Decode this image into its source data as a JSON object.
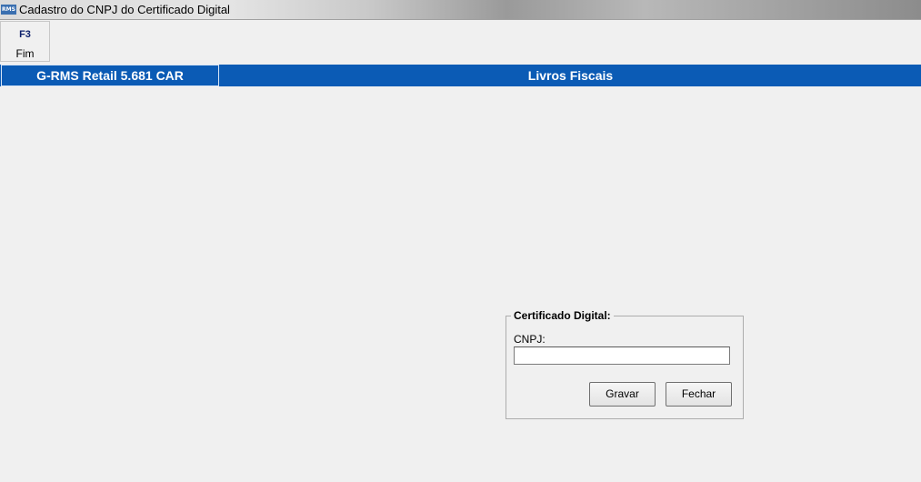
{
  "window": {
    "icon_text": "RMS",
    "title": "Cadastro do CNPJ do Certificado Digital"
  },
  "toolbar": {
    "f3_key": "F3",
    "f3_label": "Fim"
  },
  "header": {
    "product": "G-RMS Retail 5.681 CAR",
    "module": "Livros Fiscais"
  },
  "certificado": {
    "group_title": "Certificado Digital:",
    "cnpj_label": "CNPJ:",
    "cnpj_value": "",
    "gravar_label": "Gravar",
    "fechar_label": "Fechar"
  }
}
